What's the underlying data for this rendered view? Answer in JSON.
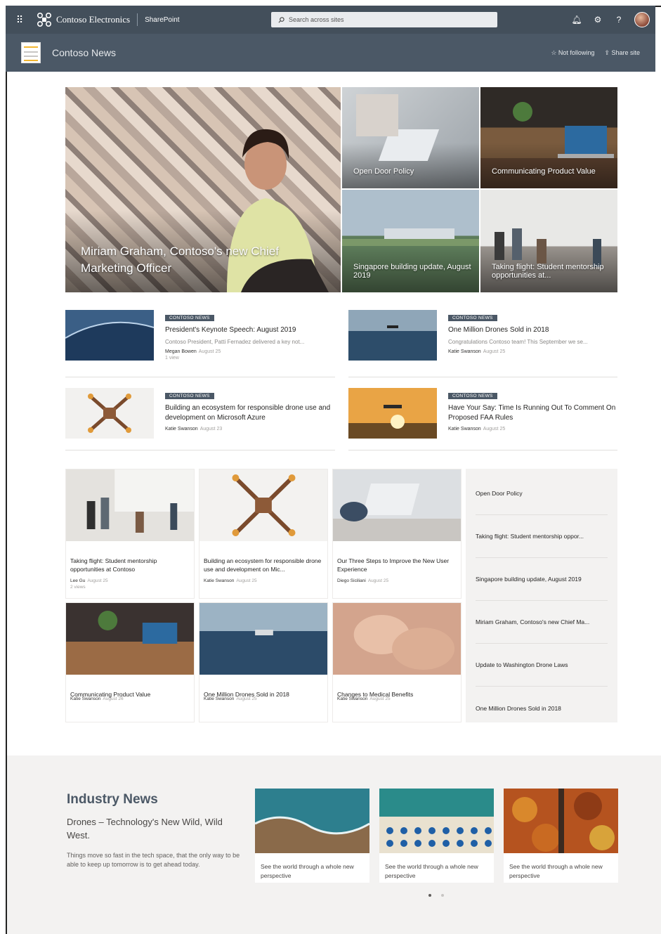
{
  "suite_bar": {
    "org_name": "Contoso Electronics",
    "app_name": "SharePoint",
    "search_placeholder": "Search across sites"
  },
  "site_header": {
    "title": "Contoso News",
    "follow_label": "Not following",
    "share_label": "Share site"
  },
  "hero": {
    "main": "Miriam Graham, Contoso's new Chief Marketing Officer",
    "tiles": [
      "Open Door Policy",
      "Communicating Product Value",
      "Singapore building update, August 2019",
      "Taking flight: Student mentorship opportunities at..."
    ]
  },
  "news": [
    {
      "badge": "CONTOSO NEWS",
      "title": "President's Keynote Speech: August 2019",
      "desc": "Contoso President, Patti Fernadez delivered a key not...",
      "author": "Megan Bowen",
      "date": "August 25",
      "views": "1 view"
    },
    {
      "badge": "CONTOSO NEWS",
      "title": "One Million Drones Sold in 2018",
      "desc": "Congratulations Contoso team! This September we se...",
      "author": "Katie Swanson",
      "date": "August 25",
      "views": ""
    },
    {
      "badge": "CONTOSO NEWS",
      "title": "Building an ecosystem for responsible drone use and development on Microsoft Azure",
      "desc": "",
      "author": "Katie Swanson",
      "date": "August 23",
      "views": ""
    },
    {
      "badge": "CONTOSO NEWS",
      "title": "Have Your Say: Time Is Running Out To Comment On Proposed FAA Rules",
      "desc": "",
      "author": "Katie Swanson",
      "date": "August 25",
      "views": ""
    }
  ],
  "cards": [
    {
      "title": "Taking flight: Student mentorship opportunities at Contoso",
      "author": "Lee Gu",
      "date": "August 25",
      "views": "2 views"
    },
    {
      "title": "Building an ecosystem for responsible drone use and development on Mic...",
      "author": "Katie Swanson",
      "date": "August 25",
      "views": ""
    },
    {
      "title": "Our Three Steps to Improve the New User Experience",
      "author": "Diego Siciliani",
      "date": "August 25",
      "views": ""
    },
    {
      "title": "Communicating Product Value",
      "author": "Katie Swanson",
      "date": "August 26",
      "views": ""
    },
    {
      "title": "One Million Drones Sold in 2018",
      "author": "Katie Swanson",
      "date": "August 25",
      "views": ""
    },
    {
      "title": "Changes to Medical Benefits",
      "author": "Katie Swanson",
      "date": "August 25",
      "views": ""
    }
  ],
  "quick_links": [
    "Open Door Policy",
    "Taking flight: Student mentorship oppor...",
    "Singapore building update, August 2019",
    "Miriam Graham, Contoso's new Chief Ma...",
    "Update to Washington Drone Laws",
    "One Million Drones Sold in 2018"
  ],
  "industry": {
    "heading": "Industry News",
    "subheading": "Drones – Technology's New Wild, Wild West.",
    "description": "Things move so fast in the tech space, that the only way to be able to keep up tomorrow is to get ahead today.",
    "cards": [
      "See the world through a whole new perspective",
      "See the world through a whole new perspective",
      "See the world through a whole new perspective"
    ]
  },
  "colors": {
    "suite_bar": "#434f5b",
    "site_header": "#4b5866",
    "badge": "#4b5866"
  }
}
